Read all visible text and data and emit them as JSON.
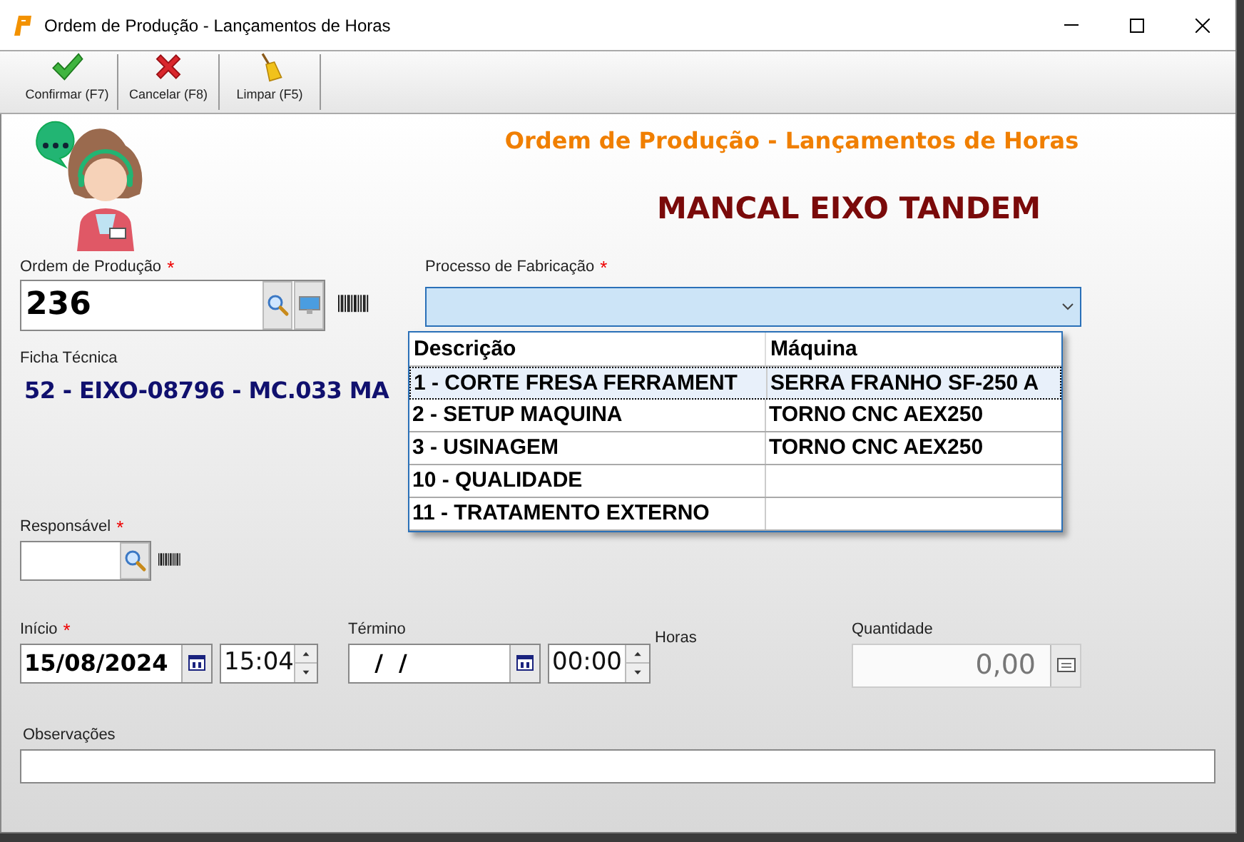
{
  "window": {
    "title": "Ordem de Produção - Lançamentos de Horas"
  },
  "toolbar": [
    {
      "kind": "confirm",
      "label": "Confirmar (F7)"
    },
    {
      "kind": "cancel",
      "label": "Cancelar (F8)"
    },
    {
      "kind": "clear",
      "label": "Limpar (F5)"
    }
  ],
  "header": {
    "title": "Ordem de Produção - Lançamentos de Horas",
    "product": "MANCAL EIXO TANDEM"
  },
  "ordem": {
    "label": "Ordem de Produção",
    "required_mark": "*",
    "value": "236"
  },
  "processo": {
    "label": "Processo de Fabricação",
    "required_mark": "*",
    "expanded": true,
    "columns": [
      "Descrição",
      "Máquina"
    ],
    "rows": [
      {
        "cells": [
          "1 - CORTE FRESA FERRAMENT",
          "SERRA FRANHO SF-250 A"
        ],
        "selected": true
      },
      {
        "cells": [
          "2 - SETUP MAQUINA",
          "TORNO CNC AEX250"
        ],
        "selected": false
      },
      {
        "cells": [
          "3 - USINAGEM",
          "TORNO CNC AEX250"
        ],
        "selected": false
      },
      {
        "cells": [
          "10 - QUALIDADE"
        ],
        "selected": false
      },
      {
        "cells": [
          "11 - TRATAMENTO EXTERNO"
        ],
        "selected": false
      }
    ]
  },
  "ficha": {
    "label": "Ficha Técnica",
    "value": "52 - EIXO-08796 - MC.033 MA"
  },
  "responsavel": {
    "label": "Responsável",
    "required_mark": "*"
  },
  "inicio": {
    "label": "Início",
    "required_mark": "*",
    "date": "15/08/2024",
    "time": "15:04"
  },
  "termino": {
    "label": "Término",
    "date": " /  /",
    "time": "00:00"
  },
  "horas": {
    "label": "Horas"
  },
  "quantidade": {
    "label": "Quantidade",
    "value": "0,00",
    "disabled": true
  },
  "observacoes": {
    "label": "Observações"
  }
}
